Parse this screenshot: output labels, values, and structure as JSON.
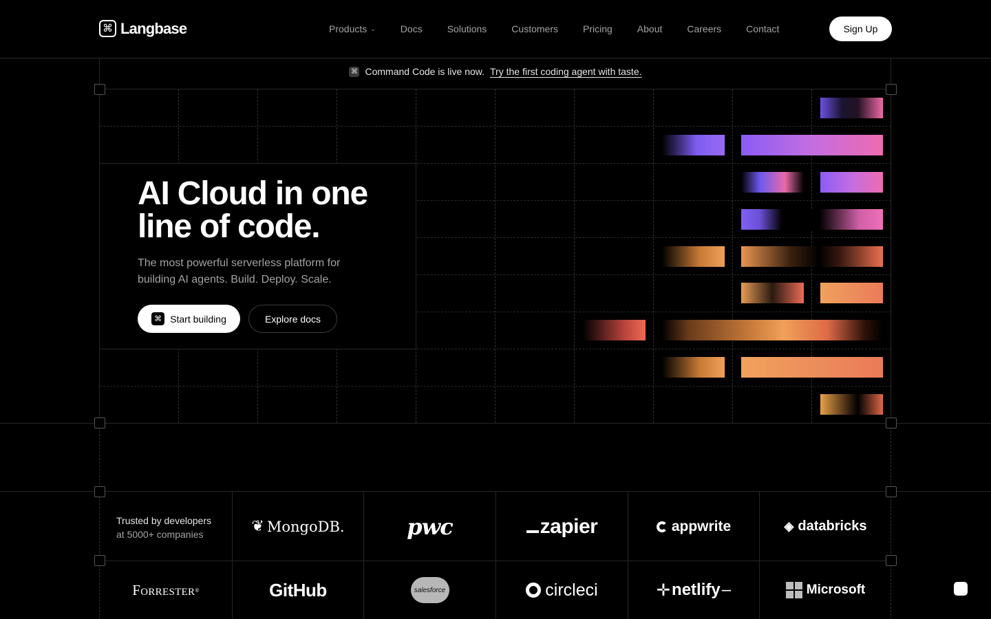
{
  "nav": {
    "brand": "Langbase",
    "brand_icon": "command-icon",
    "items": [
      {
        "label": "Products",
        "has_dropdown": true
      },
      {
        "label": "Docs"
      },
      {
        "label": "Solutions"
      },
      {
        "label": "Customers"
      },
      {
        "label": "Pricing"
      },
      {
        "label": "About"
      },
      {
        "label": "Careers"
      },
      {
        "label": "Contact"
      }
    ],
    "signup_label": "Sign Up"
  },
  "banner": {
    "icon": "command-icon",
    "text": "Command Code is live now.",
    "link": "Try the first coding agent with taste."
  },
  "hero": {
    "title": "AI Cloud in one line of code.",
    "subtitle": "The most powerful serverless platform for building AI agents. Build. Deploy. Scale.",
    "primary_cta": "Start building",
    "secondary_cta": "Explore docs"
  },
  "trusted": {
    "line1": "Trusted by developers",
    "line2": "at 5000+ companies",
    "logos": [
      "MongoDB.",
      "pwc",
      "zapier",
      "appwrite",
      "databricks",
      "Forrester",
      "GitHub",
      "salesforce",
      "circleci",
      "netlify",
      "Microsoft"
    ]
  },
  "colors": {
    "background": "#000000",
    "accent_purple": "#8b5cf6",
    "accent_pink": "#ef6bb0",
    "accent_orange": "#f0a05a"
  }
}
